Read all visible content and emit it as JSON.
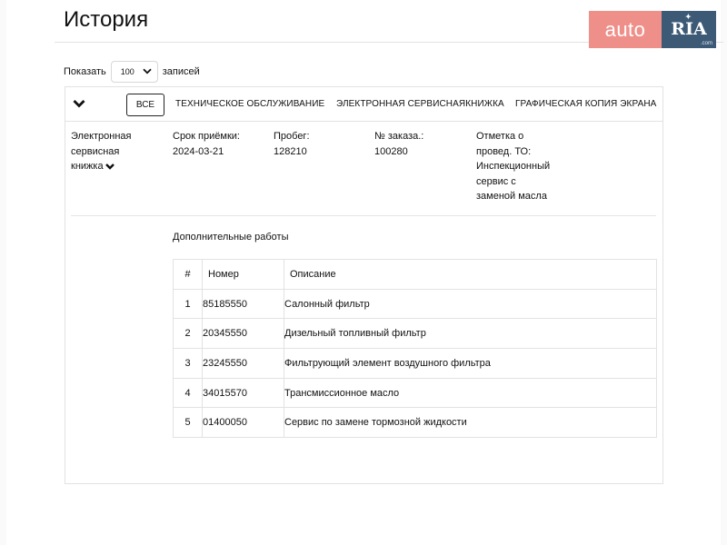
{
  "page": {
    "title": "История"
  },
  "logo": {
    "auto": "auto",
    "ria": "RIA",
    "domain": ".com"
  },
  "pagination": {
    "show_label": "Показать",
    "per_page": "100",
    "records_label": "записей"
  },
  "tabs": {
    "all": "ВСЕ",
    "service": "ТЕХНИЧЕСКОЕ ОБСЛУЖИВАНИЕ",
    "ebook": "ЭЛЕКТРОННАЯ СЕРВИСНАЯКНИЖКА",
    "screen_copy": "ГРАФИЧЕСКАЯ КОПИЯ ЭКРАНА"
  },
  "record": {
    "type_lines": [
      "Электронная",
      "сервисная",
      "книжка"
    ],
    "date_label": "Срок приёмки:",
    "date_value": "2024-03-21",
    "mileage_label": "Пробег:",
    "mileage_value": "128210",
    "order_label": "№ заказа.:",
    "order_value": "100280",
    "note_lines": [
      "Отметка о",
      "провед. ТО:",
      "Инспекционный",
      "сервис с",
      "заменой масла"
    ]
  },
  "extra_works": {
    "title": "Дополнительные работы",
    "headers": [
      "#",
      "Номер",
      "Описание"
    ],
    "rows": [
      [
        "1",
        "85185550",
        "Салонный фильтр"
      ],
      [
        "2",
        "20345550",
        "Дизельный топливный фильтр"
      ],
      [
        "3",
        "23245550",
        "Фильтрующий элемент воздушного фильтра"
      ],
      [
        "4",
        "34015570",
        "Трансмиссионное масло"
      ],
      [
        "5",
        "01400050",
        "Сервис по замене тормозной жидкости"
      ]
    ]
  },
  "colors": {
    "logo_auto": "#ef8f89",
    "logo_ria": "#3c5a76",
    "border": "#e2e2e2"
  }
}
